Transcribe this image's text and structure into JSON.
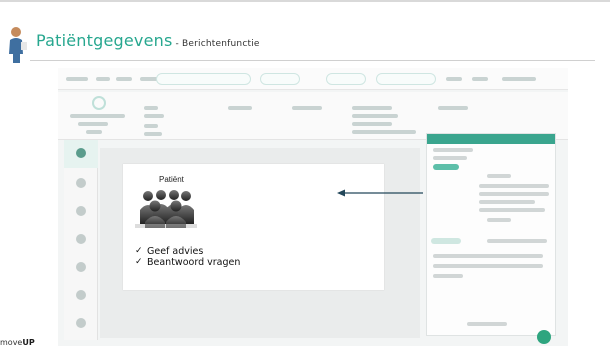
{
  "header": {
    "title": "Patiëntgegevens",
    "subtitle": "- Berichtenfunctie"
  },
  "card": {
    "patient_label": "Patiënt",
    "checks": [
      {
        "mark": "✓",
        "text": "Geef advies"
      },
      {
        "mark": "✓",
        "text": "Beantwoord vragen"
      }
    ]
  },
  "brand": {
    "prefix": "move",
    "suffix": "UP"
  },
  "colors": {
    "accent": "#27a78f",
    "panel_head": "#3aa58e",
    "arrow": "#23475a"
  },
  "icons": [
    "person-silhouette-icon",
    "people-group-icon",
    "arrow-left-icon",
    "message-fab-icon"
  ]
}
